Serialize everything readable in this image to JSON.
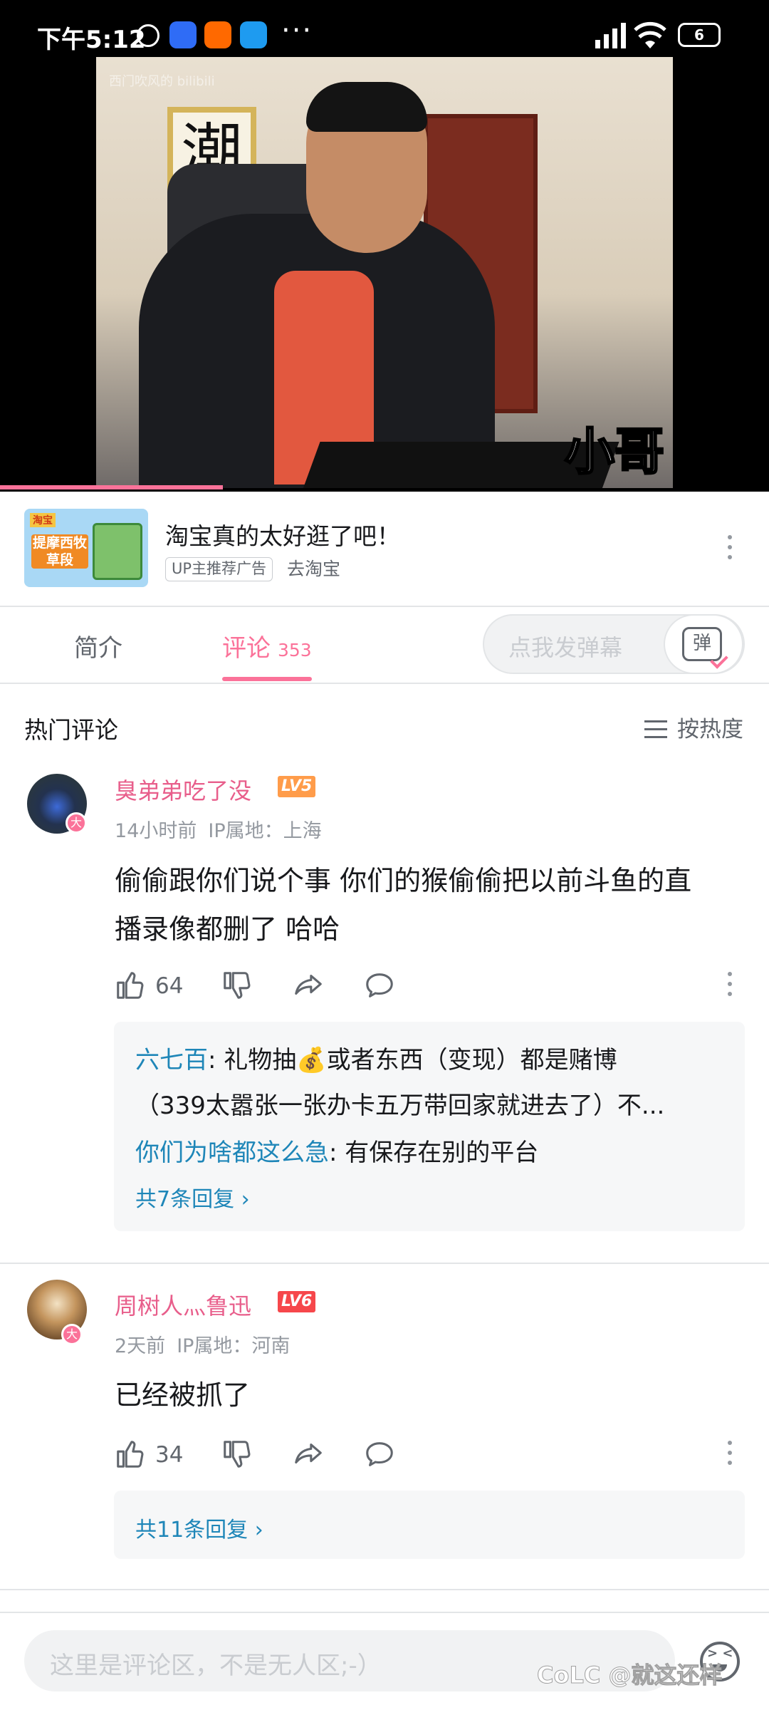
{
  "status_bar": {
    "time": "下午5:12",
    "more": "···",
    "battery": "6"
  },
  "video": {
    "watermark": "西门吹风的 bilibili",
    "calligraphy": "潮",
    "overlay_caption": "小哥",
    "progress_percent": 29
  },
  "ad": {
    "thumb_tag": "淘宝",
    "thumb_text": "提摩西牧草段",
    "title": "淘宝真的太好逛了吧！",
    "badge": "UP主推荐广告",
    "link": "去淘宝"
  },
  "tabs": {
    "intro": "简介",
    "comments": "评论",
    "comments_count": "353",
    "danmaku_placeholder": "点我发弹幕",
    "danmaku_button": "弹"
  },
  "comments_header": {
    "title": "热门评论",
    "sort": "按热度"
  },
  "comments": [
    {
      "username": "臭弟弟吃了没",
      "level": "LV5",
      "level_color": "#ff9c4a",
      "time": "14小时前",
      "ip": "IP属地：上海",
      "text_line1": "偷偷跟你们说个事  你们的猴偷偷把以前斗鱼的直",
      "text_line2": "播录像都删了  哈哈",
      "likes": "64",
      "replies": [
        {
          "who": "六七百",
          "text": ": 礼物抽💰或者东西（变现）都是赌博"
        },
        {
          "who": "",
          "text": "（339太嚣张一张办卡五万带回家就进去了）不..."
        },
        {
          "who": "你们为啥都这么急",
          "text": ": 有保存在别的平台"
        }
      ],
      "reply_more": "共7条回复 ›"
    },
    {
      "username": "周树人灬鲁迅",
      "level": "LV6",
      "level_color": "#f6474b",
      "time": "2天前",
      "ip": "IP属地：河南",
      "text_line1": "已经被抓了",
      "likes": "34",
      "reply_more": "共11条回复 ›"
    }
  ],
  "avatar_badge": "大",
  "input": {
    "placeholder": "这里是评论区，不是无人区;-）"
  },
  "corner_watermark": "CoLC @就这还样"
}
